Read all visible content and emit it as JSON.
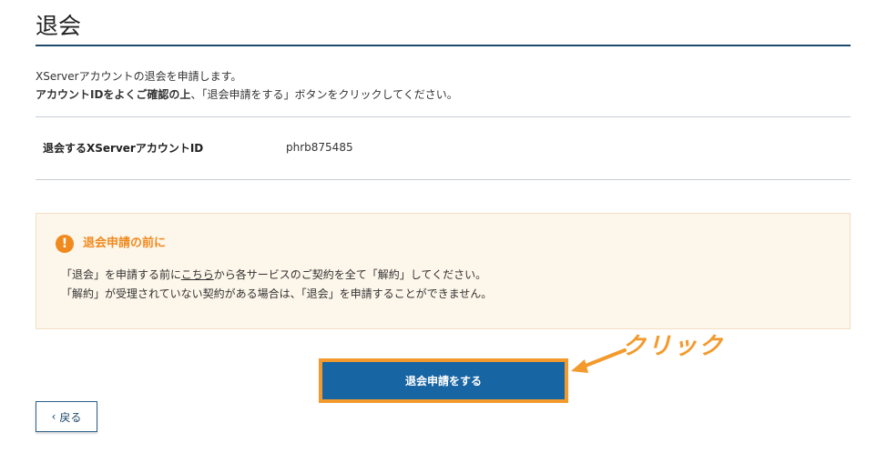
{
  "page": {
    "title": "退会"
  },
  "intro": {
    "line1": "XServerアカウントの退会を申請します。",
    "line2_bold": "アカウントIDをよくご確認の上",
    "line2_rest": "、「退会申請をする」ボタンをクリックしてください。"
  },
  "account": {
    "label": "退会するXServerアカウントID",
    "value": "phrb875485"
  },
  "notice": {
    "icon": "exclamation-icon",
    "title": "退会申請の前に",
    "line1_before": "「退会」を申請する前に",
    "line1_link": "こちら",
    "line1_after": "から各サービスのご契約を全て「解約」してください。",
    "line2": "「解約」が受理されていない契約がある場合は、「退会」を申請することができません。"
  },
  "actions": {
    "submit_label": "退会申請をする",
    "back_label": "戻る",
    "back_icon": "chevron-left-icon"
  },
  "annotation": {
    "label": "クリック",
    "color": "#f39a2d"
  },
  "colors": {
    "primary": "#1865a3",
    "accent": "#f39a2d",
    "notice_bg": "#fdf6ea",
    "title_rule": "#1f4a6b"
  }
}
